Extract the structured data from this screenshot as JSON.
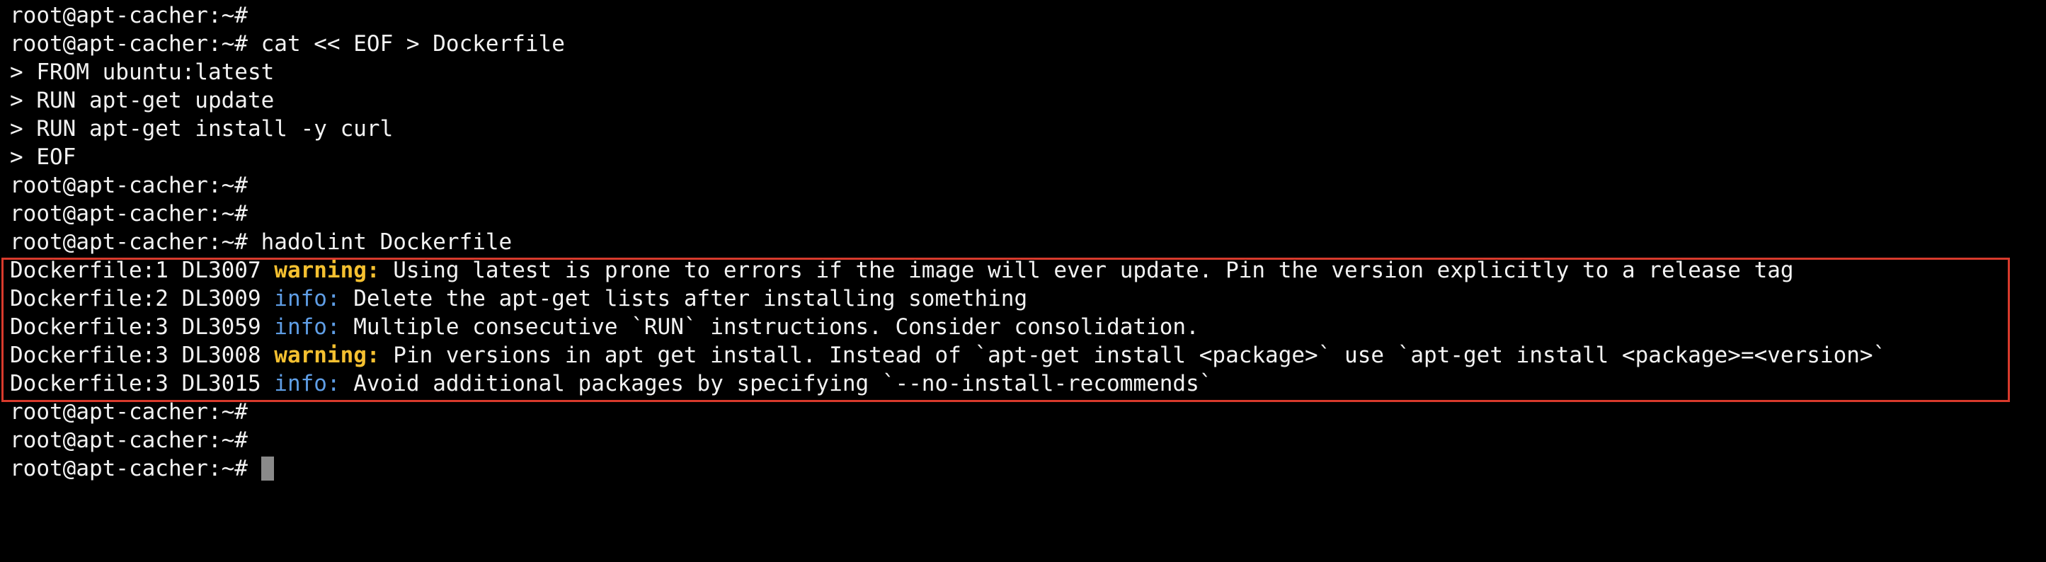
{
  "prompt": "root@apt-cacher:~#",
  "session_lines": [
    {
      "kind": "prompt",
      "text": ""
    },
    {
      "kind": "prompt",
      "text": " cat << EOF > Dockerfile"
    },
    {
      "kind": "plain",
      "text": "> FROM ubuntu:latest"
    },
    {
      "kind": "plain",
      "text": "> RUN apt-get update"
    },
    {
      "kind": "plain",
      "text": "> RUN apt-get install -y curl"
    },
    {
      "kind": "plain",
      "text": "> EOF"
    },
    {
      "kind": "prompt",
      "text": ""
    },
    {
      "kind": "prompt",
      "text": ""
    },
    {
      "kind": "prompt",
      "text": " hadolint Dockerfile"
    }
  ],
  "lint_results": [
    {
      "location": "Dockerfile:1 DL3007 ",
      "level": "warning:",
      "severity": "warning",
      "message": " Using latest is prone to errors if the image will ever update. Pin the version explicitly to a release tag"
    },
    {
      "location": "Dockerfile:2 DL3009 ",
      "level": "info:",
      "severity": "info",
      "message": " Delete the apt-get lists after installing something"
    },
    {
      "location": "Dockerfile:3 DL3059 ",
      "level": "info:",
      "severity": "info",
      "message": " Multiple consecutive `RUN` instructions. Consider consolidation."
    },
    {
      "location": "Dockerfile:3 DL3008 ",
      "level": "warning:",
      "severity": "warning",
      "message": " Pin versions in apt get install. Instead of `apt-get install <package>` use `apt-get install <package>=<version>`"
    },
    {
      "location": "Dockerfile:3 DL3015 ",
      "level": "info:",
      "severity": "info",
      "message": " Avoid additional packages by specifying `--no-install-recommends`"
    }
  ],
  "trailing_prompts": [
    {
      "text": ""
    },
    {
      "text": ""
    },
    {
      "text": " "
    }
  ],
  "colors": {
    "background": "#000000",
    "foreground": "#f2f2f2",
    "warning": "#f5c030",
    "info": "#5f9ee6",
    "highlight_border": "#d83a2c"
  }
}
